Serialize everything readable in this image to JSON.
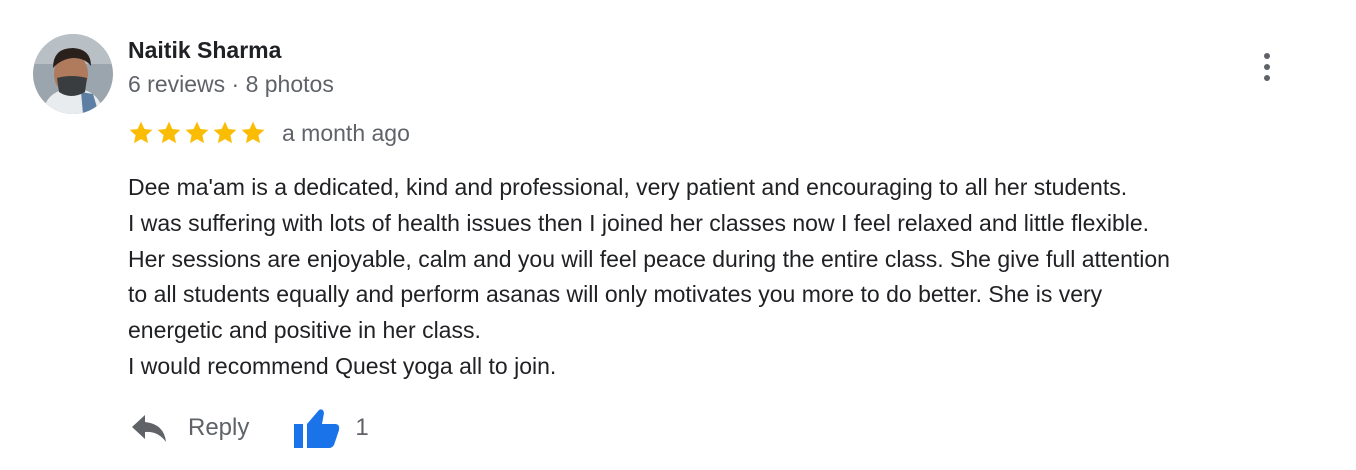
{
  "author": {
    "name": "Naitik Sharma",
    "meta": "6 reviews · 8 photos",
    "avatar_icon": "user-photo"
  },
  "review": {
    "rating": 5,
    "rating_max": 5,
    "star_color": "#fbbc04",
    "date": "a month ago",
    "text_lines": [
      "Dee ma'am is a dedicated, kind and professional, very patient and encouraging to all her students.",
      "I was suffering with lots of health issues then I joined her classes now I feel relaxed and little flexible.",
      "Her sessions are enjoyable, calm and you will feel peace during the entire class. She give full attention",
      "to all students equally and perform asanas will only motivates you more to do better. She is very",
      "energetic and positive in her class.",
      "I would recommend Quest yoga all to join."
    ]
  },
  "actions": {
    "reply_label": "Reply",
    "reply_icon": "reply-arrow-icon",
    "like_icon": "thumbs-up-icon",
    "like_color": "#1a73e8",
    "like_count": "1",
    "more_icon": "more-vert-icon"
  }
}
